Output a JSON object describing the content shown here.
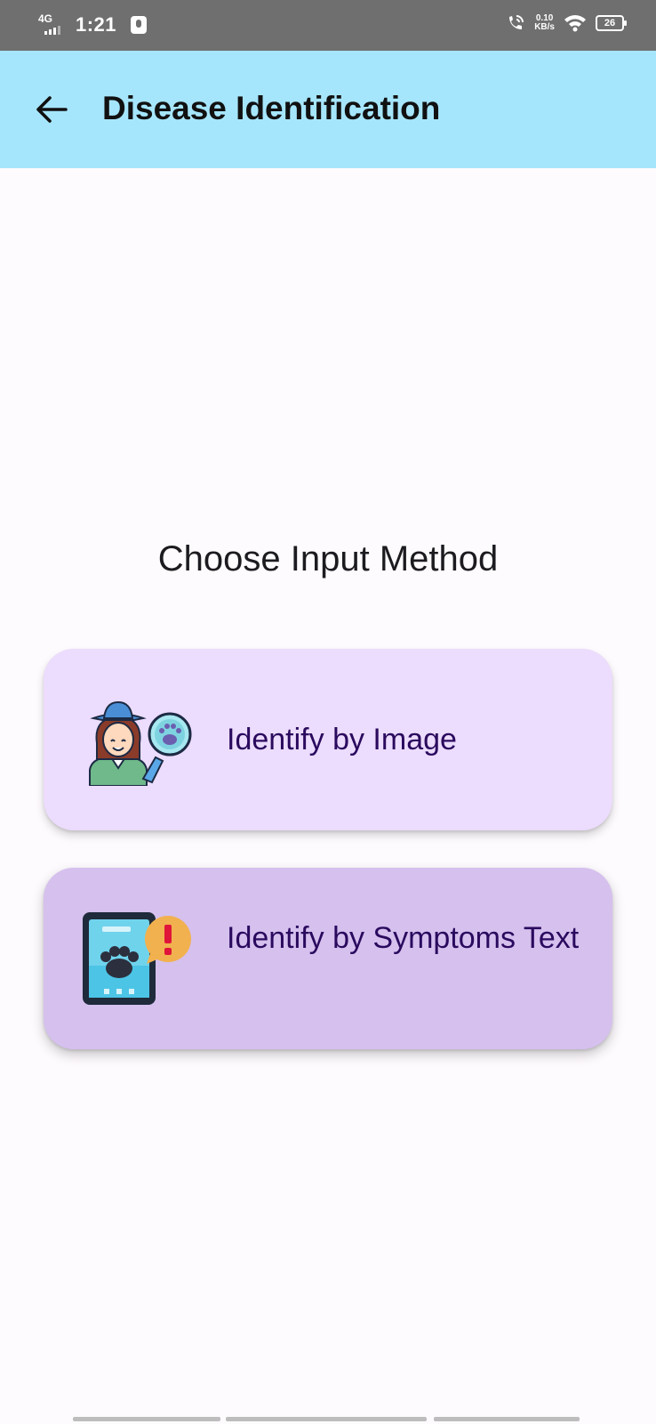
{
  "status_bar": {
    "network": "4G",
    "time": "1:21",
    "speed_value": "0.10",
    "speed_unit": "KB/s",
    "battery": "26"
  },
  "app_bar": {
    "title": "Disease Identification",
    "back_icon": "arrow-left-icon",
    "background": "#a6e6fd"
  },
  "main": {
    "heading": "Choose Input Method",
    "options": [
      {
        "label": "Identify by Image",
        "icon": "vet-with-paw-magnifier-icon",
        "background": "#ecdcfd"
      },
      {
        "label": "Identify by Symptoms Text",
        "icon": "phone-paw-alert-icon",
        "background": "#d5c0ee"
      }
    ]
  },
  "colors": {
    "page_background": "#fefbfe",
    "option_text": "#2a0a5e"
  }
}
